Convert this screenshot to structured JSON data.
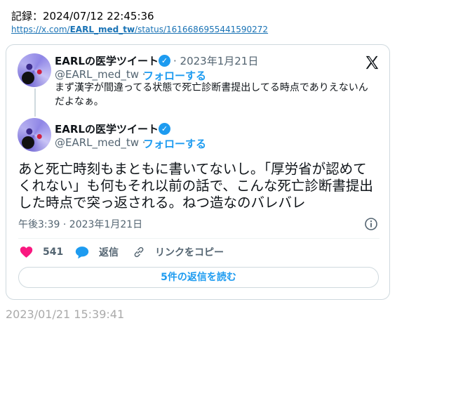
{
  "record": {
    "label": "記録：2024/07/12 22:45:36",
    "url_prefix": "https://x.com/",
    "url_user": "EARL_med_tw",
    "url_suffix": "/status/1616686955441590272"
  },
  "reply_tweet": {
    "author_name": "EARLの医学ツイート",
    "date": "· 2023年1月21日",
    "handle": "@EARL_med_tw ·",
    "follow_label": "フォローする",
    "text": "まず漢字が間違ってる状態で死亡診断書提出してる時点でありえないんだよなぁ。"
  },
  "main_tweet": {
    "author_name": "EARLの医学ツイート",
    "handle": "@EARL_med_tw ·",
    "follow_label": "フォローする",
    "text": "あと死亡時刻もまともに書いてないし。「厚労省が認めてくれない」も何もそれ以前の話で、こんな死亡診断書提出した時点で突っ返される。ねつ造なのバレバレ",
    "timestamp": "午後3:39 · 2023年1月21日"
  },
  "actions": {
    "like_count": "541",
    "reply_label": "返信",
    "copy_link_label": "リンクをコピー",
    "read_replies_label": "5件の返信を読む"
  },
  "footer": {
    "capture_time": "2023/01/21 15:39:41"
  },
  "colors": {
    "accent": "#1d9bf0",
    "like": "#f91880",
    "muted": "#536471"
  }
}
